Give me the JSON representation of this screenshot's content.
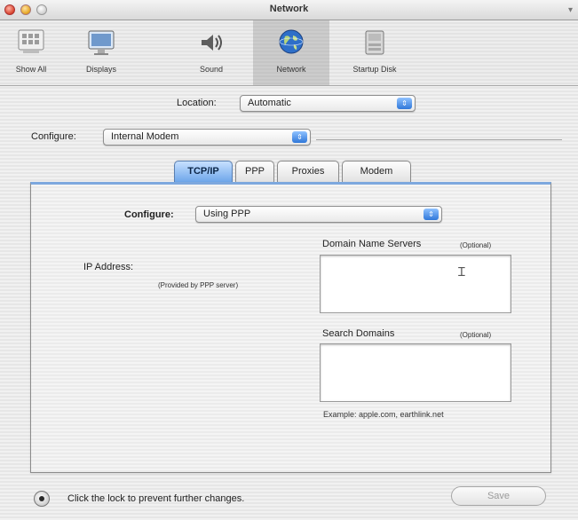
{
  "window": {
    "title": "Network"
  },
  "toolbar": {
    "items": [
      {
        "label": "Show All",
        "icon": "show-all-icon"
      },
      {
        "label": "Displays",
        "icon": "displays-icon"
      },
      {
        "label": "Sound",
        "icon": "sound-icon"
      },
      {
        "label": "Network",
        "icon": "network-icon",
        "selected": true
      },
      {
        "label": "Startup Disk",
        "icon": "startup-disk-icon"
      }
    ]
  },
  "location": {
    "label": "Location:",
    "value": "Automatic"
  },
  "configure_top": {
    "label": "Configure:",
    "value": "Internal Modem"
  },
  "tabs": [
    {
      "label": "TCP/IP",
      "active": true
    },
    {
      "label": "PPP"
    },
    {
      "label": "Proxies"
    },
    {
      "label": "Modem"
    }
  ],
  "tcpip": {
    "configure_label": "Configure:",
    "configure_value": "Using PPP",
    "ip_address_label": "IP Address:",
    "ip_address_note": "(Provided by PPP server)",
    "dns_label": "Domain Name Servers",
    "dns_optional": "(Optional)",
    "search_label": "Search Domains",
    "search_optional": "(Optional)",
    "example_text": "Example: apple.com, earthlink.net"
  },
  "footer": {
    "lock_text": "Click the lock to prevent further changes.",
    "save_label": "Save"
  }
}
